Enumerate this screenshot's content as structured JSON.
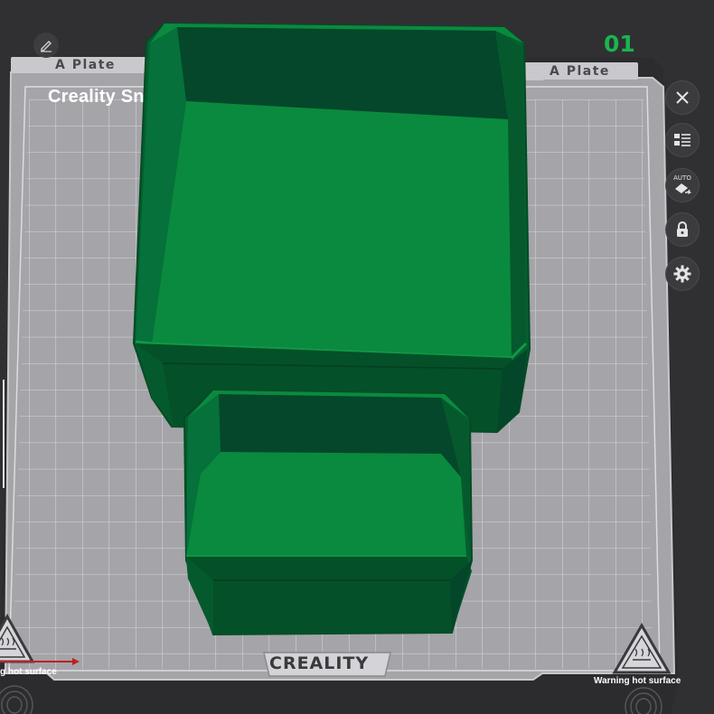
{
  "viewport": {
    "plate_tab_left": "A Plate",
    "plate_tab_right": "A Plate",
    "plate_title": "Creality Sn",
    "plate_number": "01",
    "bed_logo": "CREALITY",
    "warning_left": "g hot surface",
    "warning_right": "Warning hot surface",
    "auto_badge": "AUTO"
  },
  "toolbar": {
    "edit_icon": "pencil-icon",
    "buttons": [
      {
        "name": "close-plate-button",
        "icon": "close-icon"
      },
      {
        "name": "object-list-button",
        "icon": "list-icon"
      },
      {
        "name": "auto-orient-button",
        "icon": "auto-arrange-icon"
      },
      {
        "name": "lock-plate-button",
        "icon": "lock-icon"
      },
      {
        "name": "plate-settings-button",
        "icon": "gear-icon"
      }
    ]
  },
  "colors": {
    "background": "#303033",
    "bed": "#a3a3a8",
    "grid": "#d6d6da",
    "accent_number": "#19b54f",
    "model_green": "#0a8a3e",
    "model_dark": "#04502a"
  }
}
